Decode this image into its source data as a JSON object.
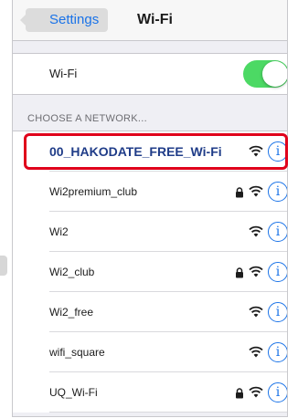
{
  "navbar": {
    "back_label": "Settings",
    "title": "Wi-Fi"
  },
  "wifi_toggle": {
    "label": "Wi-Fi",
    "on": true,
    "on_color": "#4cd964"
  },
  "section_header": "CHOOSE A NETWORK...",
  "networks": [
    {
      "name": "00_HAKODATE_FREE_Wi-Fi",
      "secured": false,
      "highlighted": true
    },
    {
      "name": "Wi2premium_club",
      "secured": true
    },
    {
      "name": "Wi2",
      "secured": false
    },
    {
      "name": "Wi2_club",
      "secured": true
    },
    {
      "name": "Wi2_free",
      "secured": false
    },
    {
      "name": "wifi_square",
      "secured": false
    },
    {
      "name": "UQ_Wi-Fi",
      "secured": true
    }
  ],
  "icons": {
    "info": "info-icon",
    "wifi": "wifi-signal-icon",
    "lock": "lock-icon",
    "back": "chevron-left-icon"
  },
  "info_glyph": "i",
  "colors": {
    "accent": "#1a73e8",
    "highlight_border": "#e0001b"
  }
}
